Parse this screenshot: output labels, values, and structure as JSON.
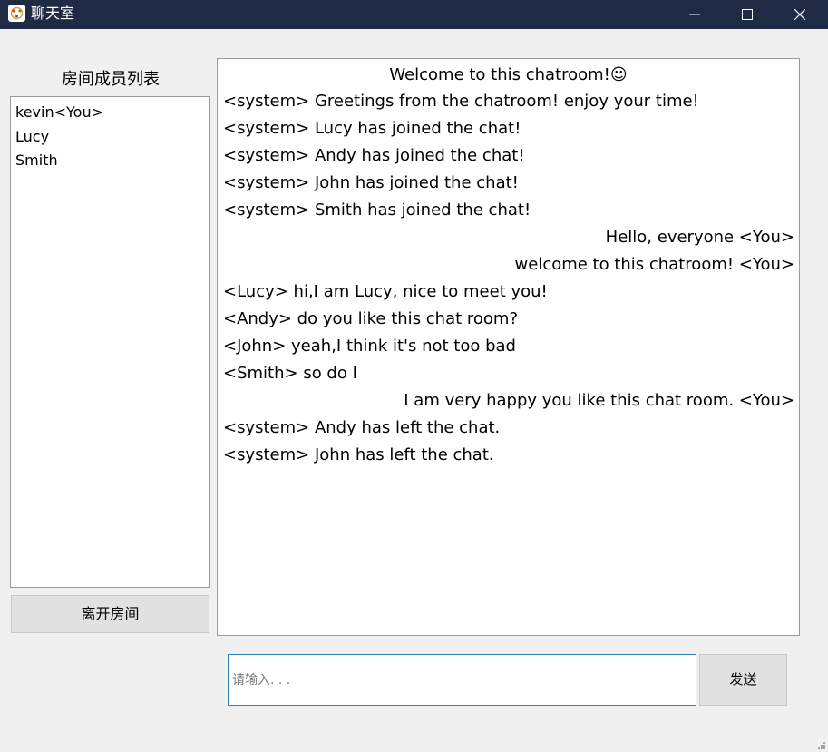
{
  "window": {
    "title": "聊天室",
    "controls": {
      "minimize_icon": "minimize-icon",
      "maximize_icon": "maximize-icon",
      "close_icon": "close-icon"
    }
  },
  "colors": {
    "titlebar": "#1f2a44",
    "input_border": "#2f7fb6",
    "window_bg": "#f0f0f0"
  },
  "members": {
    "title": "房间成员列表",
    "items": [
      "kevin<You>",
      "Lucy",
      "Smith"
    ],
    "leave_label": "离开房间"
  },
  "chat": {
    "messages": [
      {
        "text": "Welcome to this chatroom!☺",
        "align": "center"
      },
      {
        "text": "<system> Greetings from the chatroom! enjoy your time!",
        "align": "left"
      },
      {
        "text": "<system> Lucy has joined the chat!",
        "align": "left"
      },
      {
        "text": "<system> Andy has joined the chat!",
        "align": "left"
      },
      {
        "text": "<system> John has joined the chat!",
        "align": "left"
      },
      {
        "text": "<system> Smith has joined the chat!",
        "align": "left"
      },
      {
        "text": "Hello, everyone <You>",
        "align": "right"
      },
      {
        "text": "welcome to this chatroom! <You>",
        "align": "right"
      },
      {
        "text": "<Lucy> hi,I am Lucy, nice to meet you!",
        "align": "left"
      },
      {
        "text": "<Andy> do you like this chat room?",
        "align": "left"
      },
      {
        "text": "<John> yeah,I think it's not too bad",
        "align": "left"
      },
      {
        "text": "<Smith> so do I",
        "align": "left"
      },
      {
        "text": "I am very happy you like this chat room. <You>",
        "align": "right"
      },
      {
        "text": "<system> Andy has left the chat.",
        "align": "left"
      },
      {
        "text": "<system> John has left the chat.",
        "align": "left"
      }
    ]
  },
  "input": {
    "placeholder": "请输入. . .",
    "value": "",
    "send_label": "发送"
  }
}
